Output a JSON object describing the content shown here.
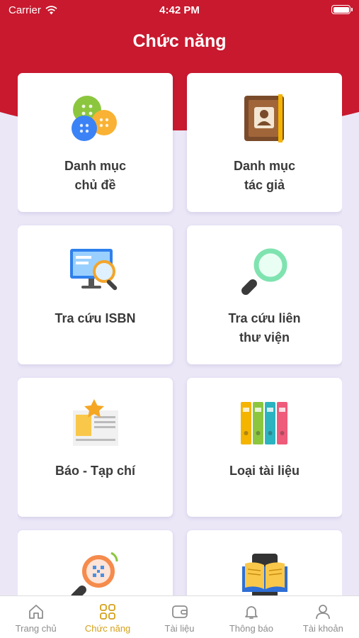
{
  "status": {
    "carrier": "Carrier",
    "time": "4:42 PM"
  },
  "header": {
    "title": "Chức năng"
  },
  "colors": {
    "primary": "#c8192e",
    "background": "#ebe7f7",
    "active_tab": "#d4a017",
    "inactive_tab": "#8e8e8e"
  },
  "functions": [
    {
      "label": "Danh mục\nchủ đề",
      "icon": "buttons-icon"
    },
    {
      "label": "Danh mục\ntác giả",
      "icon": "address-book-icon"
    },
    {
      "label": "Tra cứu ISBN",
      "icon": "monitor-search-icon"
    },
    {
      "label": "Tra cứu liên\nthư viện",
      "icon": "magnifier-icon"
    },
    {
      "label": "Báo - Tạp chí",
      "icon": "newspaper-icon"
    },
    {
      "label": "Loại tài liệu",
      "icon": "binders-icon"
    },
    {
      "label": "",
      "icon": "qr-search-icon"
    },
    {
      "label": "",
      "icon": "open-book-icon"
    }
  ],
  "tabs": [
    {
      "label": "Trang chủ",
      "icon": "home-icon",
      "active": false
    },
    {
      "label": "Chức năng",
      "icon": "grid-icon",
      "active": true
    },
    {
      "label": "Tài liệu",
      "icon": "wallet-icon",
      "active": false
    },
    {
      "label": "Thông báo",
      "icon": "bell-icon",
      "active": false
    },
    {
      "label": "Tài khoản",
      "icon": "user-icon",
      "active": false
    }
  ]
}
